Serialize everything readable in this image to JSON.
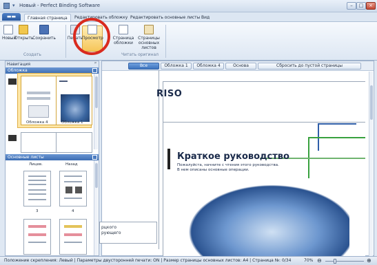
{
  "window": {
    "title": "Новый - Perfect Binding Software",
    "minimize": "–",
    "maximize": "□",
    "close": "×"
  },
  "ribbon_tabs": {
    "file": "",
    "home": "Главная страница",
    "tab2": "Редактировать обложку",
    "tab3": "Редактировать основные листы",
    "view": "Вид"
  },
  "ribbon": {
    "new": "Новый",
    "open": "Открыть",
    "save": "Сохранить",
    "group_create": "Создать",
    "print": "Печать",
    "preview": "Просмотр",
    "cover_page_1": "Страница",
    "cover_page_2": "обложки",
    "main_pages_1": "Страницы",
    "main_pages_2": "основных листов",
    "group_read": "Читать оригинал"
  },
  "nav": {
    "title": "Навигация",
    "pin": "ᵖ",
    "covers_header": "Обложка",
    "cover4_caption": "Обложка 4",
    "cover1_caption": "Обложка 1",
    "main_header": "Основные листы",
    "col_front": "Лицев.",
    "col_back": "Назад",
    "page3": "3",
    "page4": "4"
  },
  "filters": {
    "all": "Все",
    "cover1": "Обложка 1",
    "cover4": "Обложка 4",
    "base": "Основа",
    "reset": "Сбросить до пустой страницы"
  },
  "doc": {
    "logo": "RISO",
    "title": "Краткое руководство",
    "subtitle1": "Пожалуйста, начните с чтения этого руководства.",
    "subtitle2": "В нем описаны основные операции.",
    "snippet1": "рцкого",
    "snippet2": "рующего"
  },
  "status": {
    "text": "Положение скрепления: Левый  |  Параметры двусторонней печати: ON  |  Размер страницы основных листов: A4  |  Страница №: 0/34",
    "zoom": "70%"
  },
  "colors": {
    "accent": "#3d73be",
    "highlight_circle": "#d92b1f",
    "selection": "#fde6a6"
  }
}
